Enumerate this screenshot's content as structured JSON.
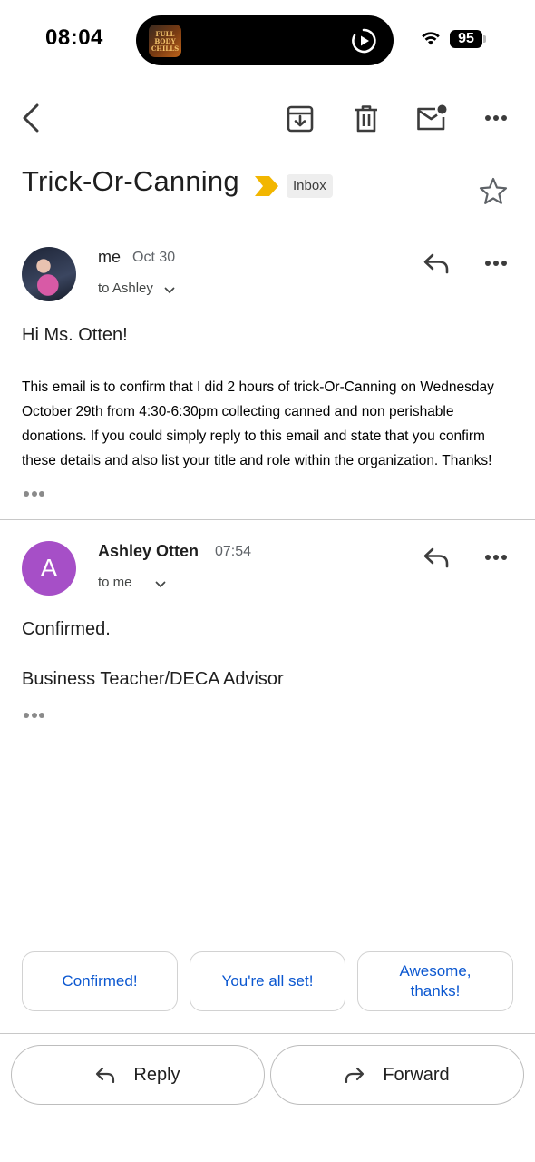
{
  "status_bar": {
    "time": "08:04",
    "battery": "95",
    "thumb_text": "FULL BODY CHILLS"
  },
  "toolbar": {
    "back": "back-arrow-icon",
    "archive": "archive-icon",
    "delete": "trash-icon",
    "mark_unread": "mark-unread-icon",
    "more": "more-horizontal-icon"
  },
  "thread": {
    "subject": "Trick-Or-Canning",
    "label": "Inbox",
    "importance_color": "#f2b600"
  },
  "messages": [
    {
      "sender": "me",
      "date": "Oct 30",
      "recipient": "to Ashley",
      "greeting": "Hi Ms. Otten!",
      "body": "This email is to confirm that I did 2 hours of trick-Or-Canning on Wednesday October 29th from 4:30-6:30pm collecting canned and non perishable donations. If you could simply reply to this email and state that you confirm these details and also list your title and role within the organization. Thanks!"
    },
    {
      "sender": "Ashley Otten",
      "avatar_letter": "A",
      "avatar_color": "#a64fc7",
      "date": "07:54",
      "recipient": "to me",
      "line1": "Confirmed.",
      "line2": "Business Teacher/DECA Advisor"
    }
  ],
  "smart_replies": [
    "Confirmed!",
    "You're all set!",
    "Awesome, thanks!"
  ],
  "actions": {
    "reply": "Reply",
    "forward": "Forward"
  },
  "colors": {
    "link_blue": "#0b57d0"
  }
}
